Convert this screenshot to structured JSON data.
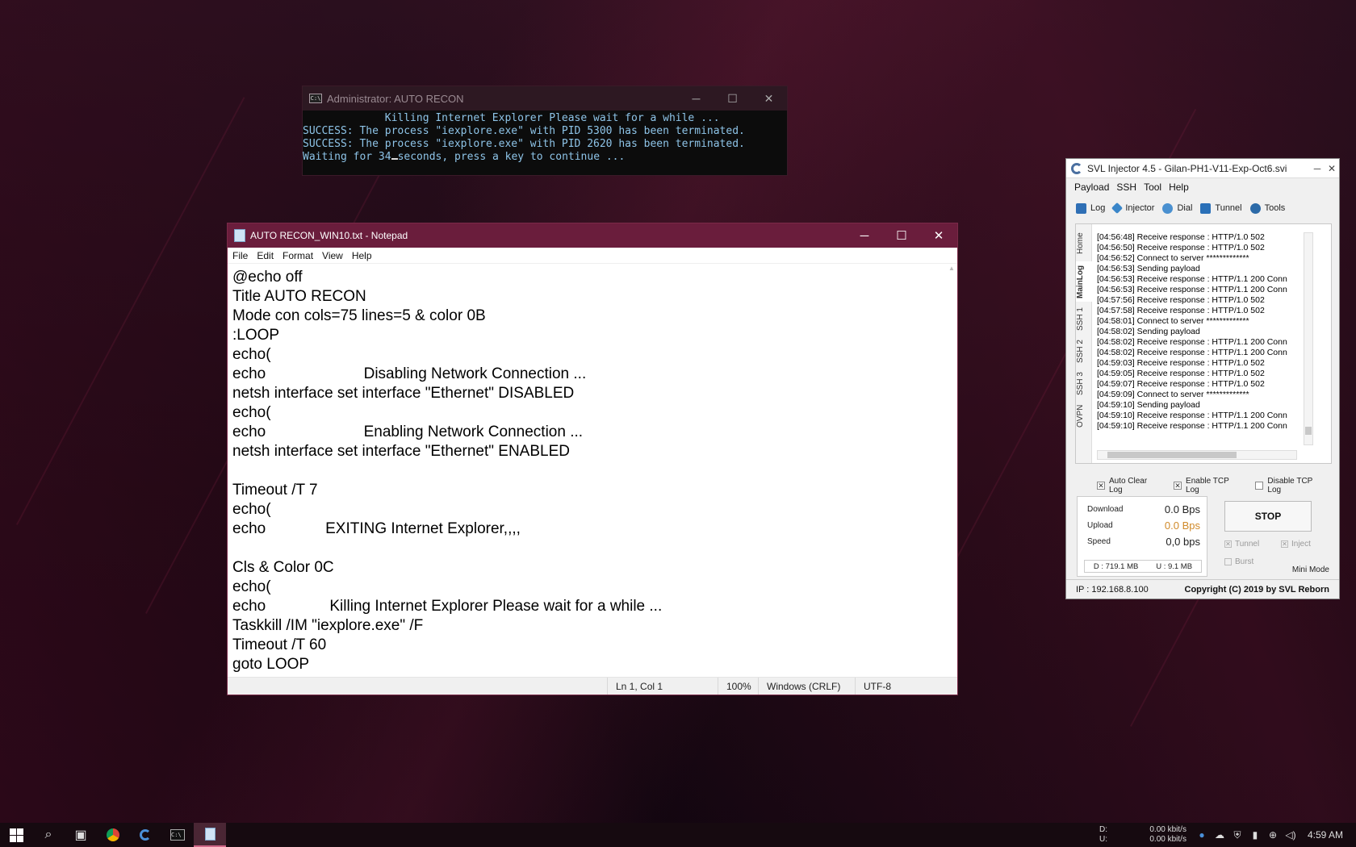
{
  "cmd": {
    "title": "Administrator:  AUTO RECON",
    "lines": [
      "             Killing Internet Explorer Please wait for a while ...",
      "SUCCESS: The process \"iexplore.exe\" with PID 5300 has been terminated.",
      "SUCCESS: The process \"iexplore.exe\" with PID 2620 has been terminated.",
      ""
    ],
    "wait_prefix": "Waiting for 34",
    "wait_suffix": "seconds, press a key to continue ..."
  },
  "notepad": {
    "title": "AUTO RECON_WIN10.txt - Notepad",
    "menu": [
      "File",
      "Edit",
      "Format",
      "View",
      "Help"
    ],
    "content": "@echo off\nTitle AUTO RECON\nMode con cols=75 lines=5 & color 0B\n:LOOP\necho(\necho                       Disabling Network Connection ...\nnetsh interface set interface \"Ethernet\" DISABLED\necho(\necho                       Enabling Network Connection ...\nnetsh interface set interface \"Ethernet\" ENABLED\n\nTimeout /T 7\necho(\necho              EXITING Internet Explorer,,,,\n\nCls & Color 0C\necho(\necho               Killing Internet Explorer Please wait for a while ...\nTaskkill /IM \"iexplore.exe\" /F\nTimeout /T 60\ngoto LOOP",
    "status": {
      "position": "Ln 1, Col 1",
      "zoom": "100%",
      "line_ending": "Windows (CRLF)",
      "encoding": "UTF-8"
    }
  },
  "svl": {
    "title": "SVL Injector 4.5 - Gilan-PH1-V11-Exp-Oct6.svi",
    "menu": [
      "Payload",
      "SSH",
      "Tool",
      "Help"
    ],
    "tabs": [
      "Log",
      "Injector",
      "Dial",
      "Tunnel",
      "Tools"
    ],
    "vtabs": [
      "Home",
      "MainLog",
      "SSH 1",
      "SSH 2",
      "SSH 3",
      "OVPN"
    ],
    "log": [
      "[04:56:48] Receive response : HTTP/1.0 502",
      "[04:56:50] Receive response : HTTP/1.0 502",
      "[04:56:52] Connect to server *************",
      "[04:56:53] Sending payload",
      "[04:56:53] Receive response : HTTP/1.1 200 Conn",
      "[04:56:53] Receive response : HTTP/1.1 200 Conn",
      "[04:57:56] Receive response : HTTP/1.0 502",
      "[04:57:58] Receive response : HTTP/1.0 502",
      "[04:58:01] Connect to server *************",
      "[04:58:02] Sending payload",
      "[04:58:02] Receive response : HTTP/1.1 200 Conn",
      "[04:58:02] Receive response : HTTP/1.1 200 Conn",
      "[04:59:03] Receive response : HTTP/1.0 502",
      "[04:59:05] Receive response : HTTP/1.0 502",
      "[04:59:07] Receive response : HTTP/1.0 502",
      "[04:59:09] Connect to server *************",
      "[04:59:10] Sending payload",
      "[04:59:10] Receive response : HTTP/1.1 200 Conn",
      "[04:59:10] Receive response : HTTP/1.1 200 Conn"
    ],
    "checks": {
      "auto_clear": "Auto Clear Log",
      "enable_tcp": "Enable TCP Log",
      "disable_tcp": "Disable TCP Log"
    },
    "stats": {
      "download_label": "Download",
      "download_value": "0.0 Bps",
      "upload_label": "Upload",
      "upload_value": "0.0 Bps",
      "speed_label": "Speed",
      "speed_value": "0,0 bps",
      "d_total": "D :  719.1 MB",
      "u_total": "U :    9.1 MB"
    },
    "stop_label": "STOP",
    "opt_tunnel": "Tunnel",
    "opt_inject": "Inject",
    "opt_burst": "Burst",
    "mini_mode": "Mini Mode",
    "ip": "IP : 192.168.8.100",
    "copyright": "Copyright (C) 2019 by SVL Reborn",
    "accent_upload": "#d08a2a"
  },
  "taskbar": {
    "net_d_label": "D:",
    "net_d_value": "0.00 kbit/s",
    "net_u_label": "U:",
    "net_u_value": "0.00 kbit/s",
    "time": "4:59 AM"
  }
}
